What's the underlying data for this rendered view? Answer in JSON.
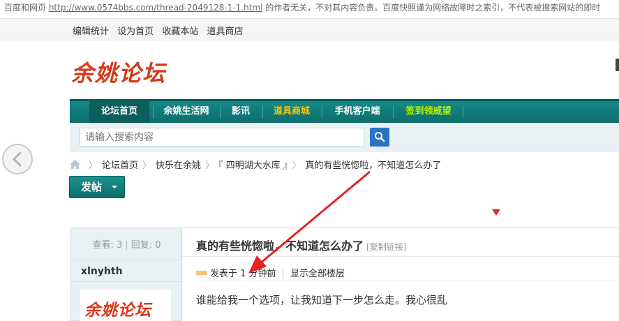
{
  "snapshot": {
    "prefix": "百度和网页 ",
    "url": "http://www.0574bbs.com/thread-2049128-1-1.html",
    "suffix": " 的作者无关，不对其内容负责。百度快照谨为网络故障时之索引，不代表被搜索网站的即时"
  },
  "top_links": [
    "编辑统计",
    "设为首页",
    "收藏本站",
    "道具商店"
  ],
  "logo_text": "余姚论坛",
  "nav": {
    "items": [
      {
        "label": "论坛首页",
        "style": "active"
      },
      {
        "label": "余姚生活网",
        "style": "normal"
      },
      {
        "label": "影讯",
        "style": "normal"
      },
      {
        "label": "道具商城",
        "style": "yellow"
      },
      {
        "label": "手机客户端",
        "style": "normal"
      },
      {
        "label": "签到领威望",
        "style": "lime"
      }
    ]
  },
  "search": {
    "placeholder": "请输入搜索内容"
  },
  "breadcrumb": {
    "items": [
      "论坛首页",
      "快乐在余姚",
      "『 四明湖大水库 』",
      "真的有些恍惚啦，不知道怎么办了"
    ],
    "separator": "〉"
  },
  "post_button": {
    "label": "发帖"
  },
  "stats": {
    "views_label": "查看:",
    "views": "3",
    "replies_label": "回复:",
    "replies": "0"
  },
  "author": {
    "username": "xlnyhth",
    "avatar_text": "余姚论坛"
  },
  "thread": {
    "title": "真的有些恍惚啦，不知道怎么办了",
    "copy_link": "[复制链接]",
    "posted": "发表于 1 分钟前",
    "show_all": "显示全部楼层",
    "content": "谁能给我一个选项，让我知道下一步怎么走。我心很乱"
  },
  "colors": {
    "nav_bg": "#0c6e6c",
    "logo": "#d6391a",
    "search_btn": "#2a72c6",
    "arrow": "#e62222"
  },
  "icons": [
    "home-icon",
    "search-icon",
    "back-arrow-icon",
    "caret-down-icon"
  ]
}
